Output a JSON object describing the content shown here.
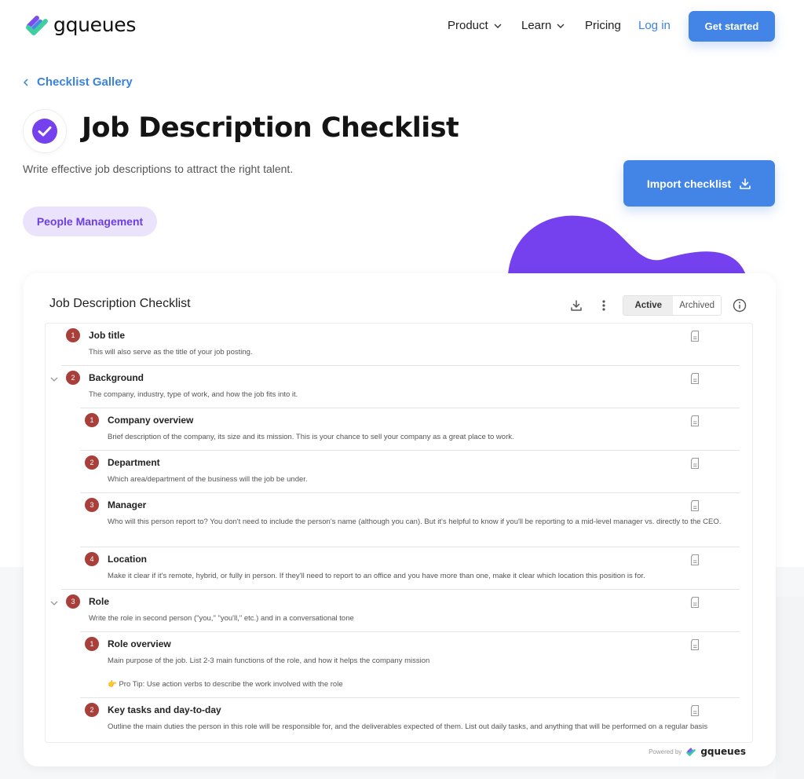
{
  "nav": {
    "logo_text": "gqueues",
    "items": [
      {
        "label": "Product",
        "has_dropdown": true
      },
      {
        "label": "Learn",
        "has_dropdown": true
      },
      {
        "label": "Pricing",
        "has_dropdown": false
      }
    ],
    "login_label": "Log in",
    "cta_label": "Get started"
  },
  "hero": {
    "breadcrumb_label": "Checklist Gallery",
    "title": "Job Description Checklist",
    "subtitle": "Write effective job descriptions to attract the right talent.",
    "tag": "People Management",
    "import_label": "Import checklist"
  },
  "colors": {
    "primary": "#4285e6",
    "accent_purple": "#7540ee",
    "tag_bg": "#ebe3fc",
    "number_badge": "#a83f3a"
  },
  "card": {
    "title": "Job Description Checklist",
    "tabs": [
      {
        "label": "Active",
        "selected": true
      },
      {
        "label": "Archived",
        "selected": false
      }
    ],
    "items": [
      {
        "number": "1",
        "level": 0,
        "collapsible": false,
        "title": "Job title",
        "desc": "This will also serve as the title of your job posting."
      },
      {
        "number": "2",
        "level": 0,
        "collapsible": true,
        "title": "Background",
        "desc": "The company, industry, type of work, and how the job fits into it."
      },
      {
        "number": "1",
        "level": 1,
        "collapsible": false,
        "title": "Company overview",
        "desc": "Brief description of the company, its size and its mission. This is your chance to sell your company as a great place to work."
      },
      {
        "number": "2",
        "level": 1,
        "collapsible": false,
        "title": "Department",
        "desc": "Which area/department of the business will the job be under."
      },
      {
        "number": "3",
        "level": 1,
        "collapsible": false,
        "title": "Manager",
        "desc": "Who will this person report to? You don't need to include the person's name (although you can). But it's helpful to know if you'll be reporting to a mid-level manager vs. directly to the CEO."
      },
      {
        "number": "4",
        "level": 1,
        "collapsible": false,
        "title": "Location",
        "desc": "Make it clear if it's remote, hybrid, or fully in person. If they'll need to report to an office and you have more than one, make it clear which location this position is for."
      },
      {
        "number": "3",
        "level": 0,
        "collapsible": true,
        "title": "Role",
        "desc": "Write the role in second person (\"you,\" \"you'll,\" etc.) and in a conversational tone"
      },
      {
        "number": "1",
        "level": 1,
        "collapsible": false,
        "title": "Role overview",
        "desc": "Main purpose of the job. List 2-3 main functions of the role, and how it helps the company mission",
        "tip": "👉 Pro Tip: Use action verbs to describe the work involved with the role"
      },
      {
        "number": "2",
        "level": 1,
        "collapsible": false,
        "title": "Key tasks and day-to-day",
        "desc": "Outline the main duties the person in this role will be responsible for, and the deliverables expected of them. List out daily tasks, and anything that will be performed on a regular basis"
      }
    ],
    "powered_by_label": "Powered by",
    "powered_by_brand": "gqueues"
  }
}
